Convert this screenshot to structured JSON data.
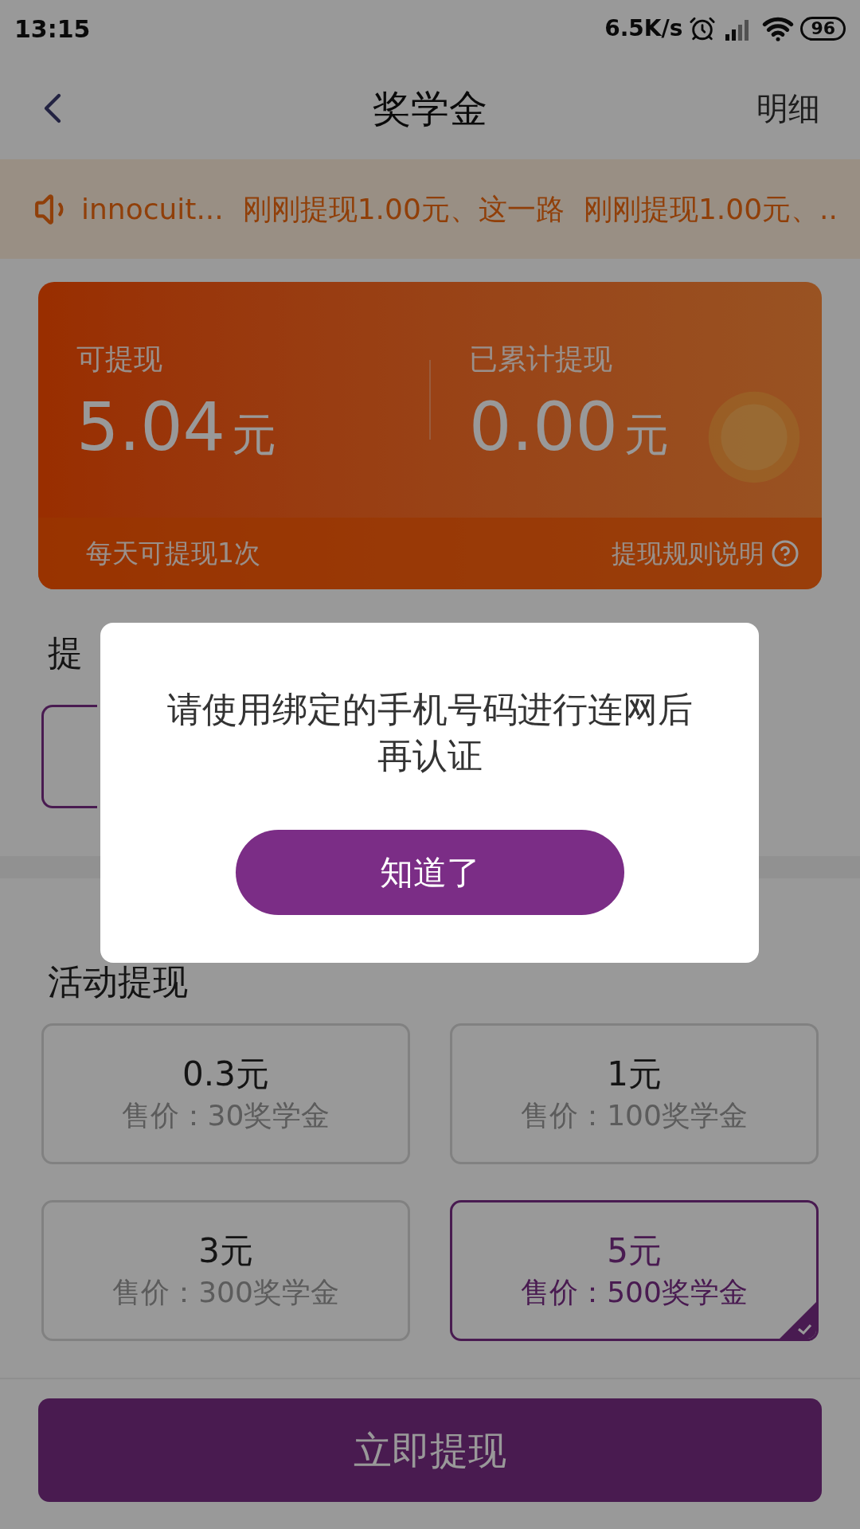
{
  "status_bar": {
    "time": "13:15",
    "speed": "6.5K/s",
    "battery": "96"
  },
  "nav": {
    "title": "奖学金",
    "action": "明细"
  },
  "ticker": {
    "items": [
      "innocuit...",
      "刚刚提现1.00元、这一路",
      "刚刚提现1.00元、.."
    ]
  },
  "balance_card": {
    "available_label": "可提现",
    "available_amount": "5.04",
    "available_unit": "元",
    "total_label": "已累计提现",
    "total_amount": "0.00",
    "total_unit": "元",
    "daily_note": "每天可提现1次",
    "rules_link": "提现规则说明"
  },
  "withdraw_section": {
    "heading": "提",
    "option": {
      "selected": true
    }
  },
  "activity_section": {
    "heading": "活动提现",
    "options": [
      {
        "amount": "0.3元",
        "price": "售价：30奖学金",
        "selected": false
      },
      {
        "amount": "1元",
        "price": "售价：100奖学金",
        "selected": false
      },
      {
        "amount": "3元",
        "price": "售价：300奖学金",
        "selected": false
      },
      {
        "amount": "5元",
        "price": "售价：500奖学金",
        "selected": true
      }
    ]
  },
  "submit_button": "立即提现",
  "dialog": {
    "message": "请使用绑定的手机号码进行连网后再认证",
    "button": "知道了"
  }
}
